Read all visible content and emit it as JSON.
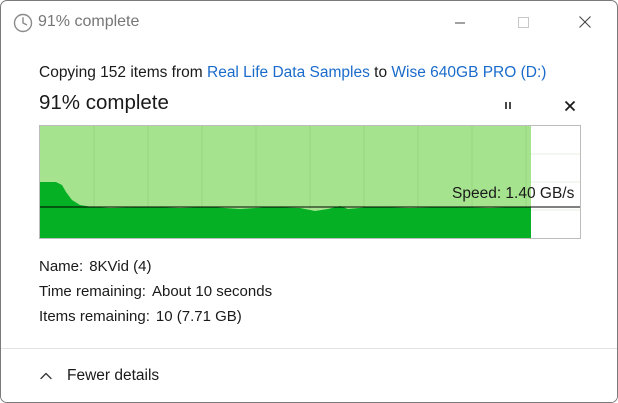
{
  "window": {
    "title": "91% complete",
    "icon": "clock-icon"
  },
  "copy": {
    "prefix": "Copying 152 items from",
    "source": "Real Life Data Samples",
    "connector": "to",
    "destination": "Wise 640GB PRO (D:)"
  },
  "progress": {
    "heading": "91% complete",
    "percent": 91,
    "speed_text": "Speed: 1.40 GB/s",
    "colors": {
      "fill_light": "#a6e38f",
      "fill_dark": "#06b025",
      "speed_line": "#000000",
      "grid": "#c8e6bd",
      "border": "#bcbcbc"
    }
  },
  "details": {
    "name_label": "Name:",
    "name_value": "8KVid (4)",
    "time_label": "Time remaining:",
    "time_value": "About 10 seconds",
    "items_label": "Items remaining:",
    "items_value": "10 (7.71 GB)"
  },
  "footer": {
    "toggle_label": "Fewer details"
  }
}
